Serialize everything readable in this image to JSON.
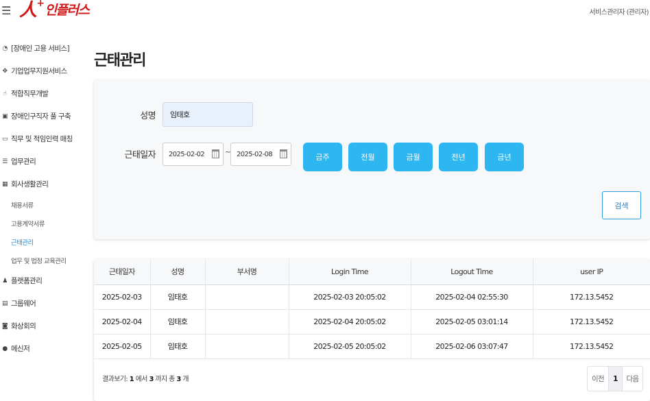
{
  "header": {
    "menu_icon": "hamburger-icon",
    "logo": {
      "big": "人",
      "plus": "+",
      "rest": "인플러스"
    },
    "user_label": "서비스관리자 (관리자)"
  },
  "sidebar": {
    "items": [
      {
        "icon": "pie-chart-icon",
        "glyph": "◔",
        "label": "[장애인 고용 서비스]"
      },
      {
        "icon": "handshake-icon",
        "glyph": "✥",
        "label": "기업업무지원서비스"
      },
      {
        "icon": "thumbs-up-icon",
        "glyph": "☝",
        "label": "적합직무개발"
      },
      {
        "icon": "id-card-icon",
        "glyph": "▣",
        "label": "장애인구직자 풀 구축"
      },
      {
        "icon": "chat-icon",
        "glyph": "▭",
        "label": "직무 및 적임인력 매칭"
      },
      {
        "icon": "list-icon",
        "glyph": "☰",
        "label": "업무관리"
      },
      {
        "icon": "grid-icon",
        "glyph": "▦",
        "label": "회사생활관리"
      }
    ],
    "sub_items": [
      {
        "label": "채용서류"
      },
      {
        "label": "고용계약서류"
      },
      {
        "label": "근태관리"
      },
      {
        "label": "업무 및 법정 교육관리"
      }
    ],
    "items_after": [
      {
        "icon": "users-icon",
        "glyph": "♟",
        "label": "플랫폼관리"
      },
      {
        "icon": "document-icon",
        "glyph": "▤",
        "label": "그룹웨어"
      },
      {
        "icon": "video-icon",
        "glyph": "◙",
        "label": "화상회의"
      },
      {
        "icon": "message-icon",
        "glyph": "●",
        "label": "메신저"
      }
    ],
    "active_sub": "근태관리"
  },
  "main": {
    "title": "근태관리",
    "search": {
      "name_label": "성명",
      "name_value": "임태호",
      "date_label": "근태일자",
      "date_from": "2025-02-02",
      "date_to": "2025-02-08",
      "tilde": "~",
      "quick_buttons": [
        "금주",
        "전월",
        "금월",
        "전년",
        "금년"
      ],
      "search_label": "검색"
    },
    "table": {
      "columns": [
        "근태일자",
        "성명",
        "부서명",
        "Login Time",
        "Logout Time",
        "user IP"
      ],
      "rows": [
        [
          "2025-02-03",
          "임태호",
          "",
          "2025-02-03 20:05:02",
          "2025-02-04 02:55:30",
          "172.13.5452"
        ],
        [
          "2025-02-04",
          "임태호",
          "",
          "2025-02-04 20:05:02",
          "2025-02-05 03:01:14",
          "172.13.5452"
        ],
        [
          "2025-02-05",
          "임태호",
          "",
          "2025-02-05 20:05:02",
          "2025-02-06 03:07:47",
          "172.13.5452"
        ]
      ],
      "summary": {
        "prefix": "결과보기: ",
        "from": "1",
        "mid1": " 에서 ",
        "to": "3",
        "mid2": " 까지 총 ",
        "total": "3",
        "suffix": " 개"
      },
      "pager": {
        "prev": "이전",
        "current": "1",
        "next": "다음"
      }
    }
  },
  "colors": {
    "accent": "#2eb6f0",
    "brand": "#d01818",
    "active_link": "#1e8fd6"
  }
}
